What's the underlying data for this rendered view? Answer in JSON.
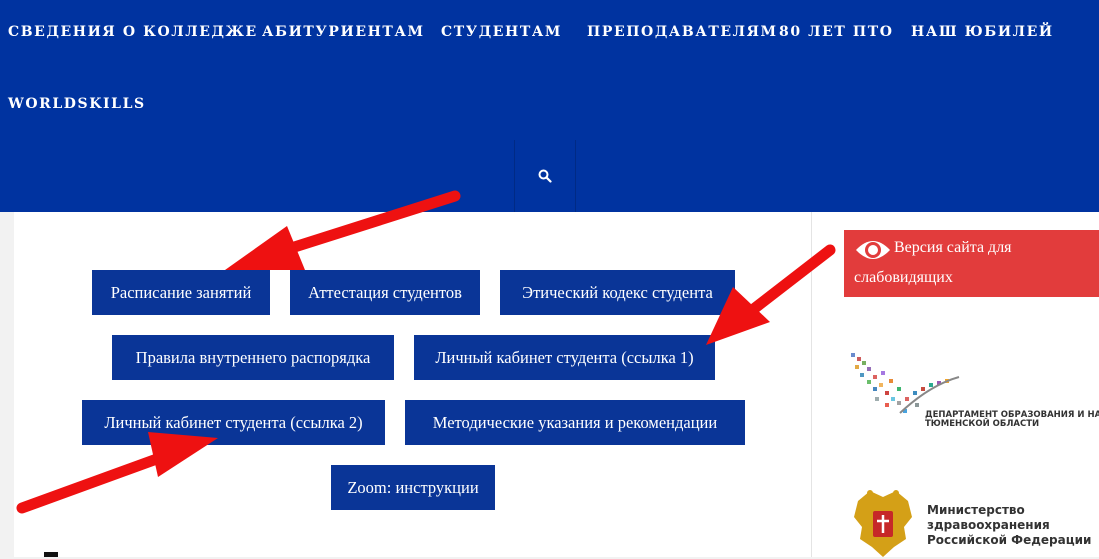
{
  "nav": {
    "items": [
      "СВЕДЕНИЯ О КОЛЛЕДЖЕ",
      "АБИТУРИЕНТАМ",
      "СТУДЕНТАМ",
      "ПРЕПОДАВАТЕЛЯМ",
      "80 ЛЕТ ПТО",
      "НАШ ЮБИЛЕЙ",
      "WORLDSKILLS"
    ],
    "search_icon": "search-icon"
  },
  "buttons": {
    "schedule": "Расписание занятий",
    "attestation": "Аттестация студентов",
    "ethics": "Этический кодекс студента",
    "rules": "Правила внутреннего распорядка",
    "cabinet1": "Личный кабинет студента (ссылка 1)",
    "cabinet2": "Личный кабинет студента (ссылка 2)",
    "methods": "Методические указания и рекомендации",
    "zoom": "Zoom: инструкции"
  },
  "sidebar": {
    "visually_impaired_line1": "Версия сайта для",
    "visually_impaired_line2": "слабовидящих",
    "dept_logo_line1": "ДЕПАРТАМЕНТ ОБРАЗОВАНИЯ И НАУКИ",
    "dept_logo_line2": "ТЮМЕНСКОЙ ОБЛАСТИ",
    "ministry_line1": "Министерство",
    "ministry_line2": "здравоохранения",
    "ministry_line3": "Российской Федерации"
  },
  "colors": {
    "header_bg": "#0033a0",
    "button_bg": "#0a3597",
    "accent_red": "#e23c3c",
    "arrow_red": "#ee1111"
  }
}
